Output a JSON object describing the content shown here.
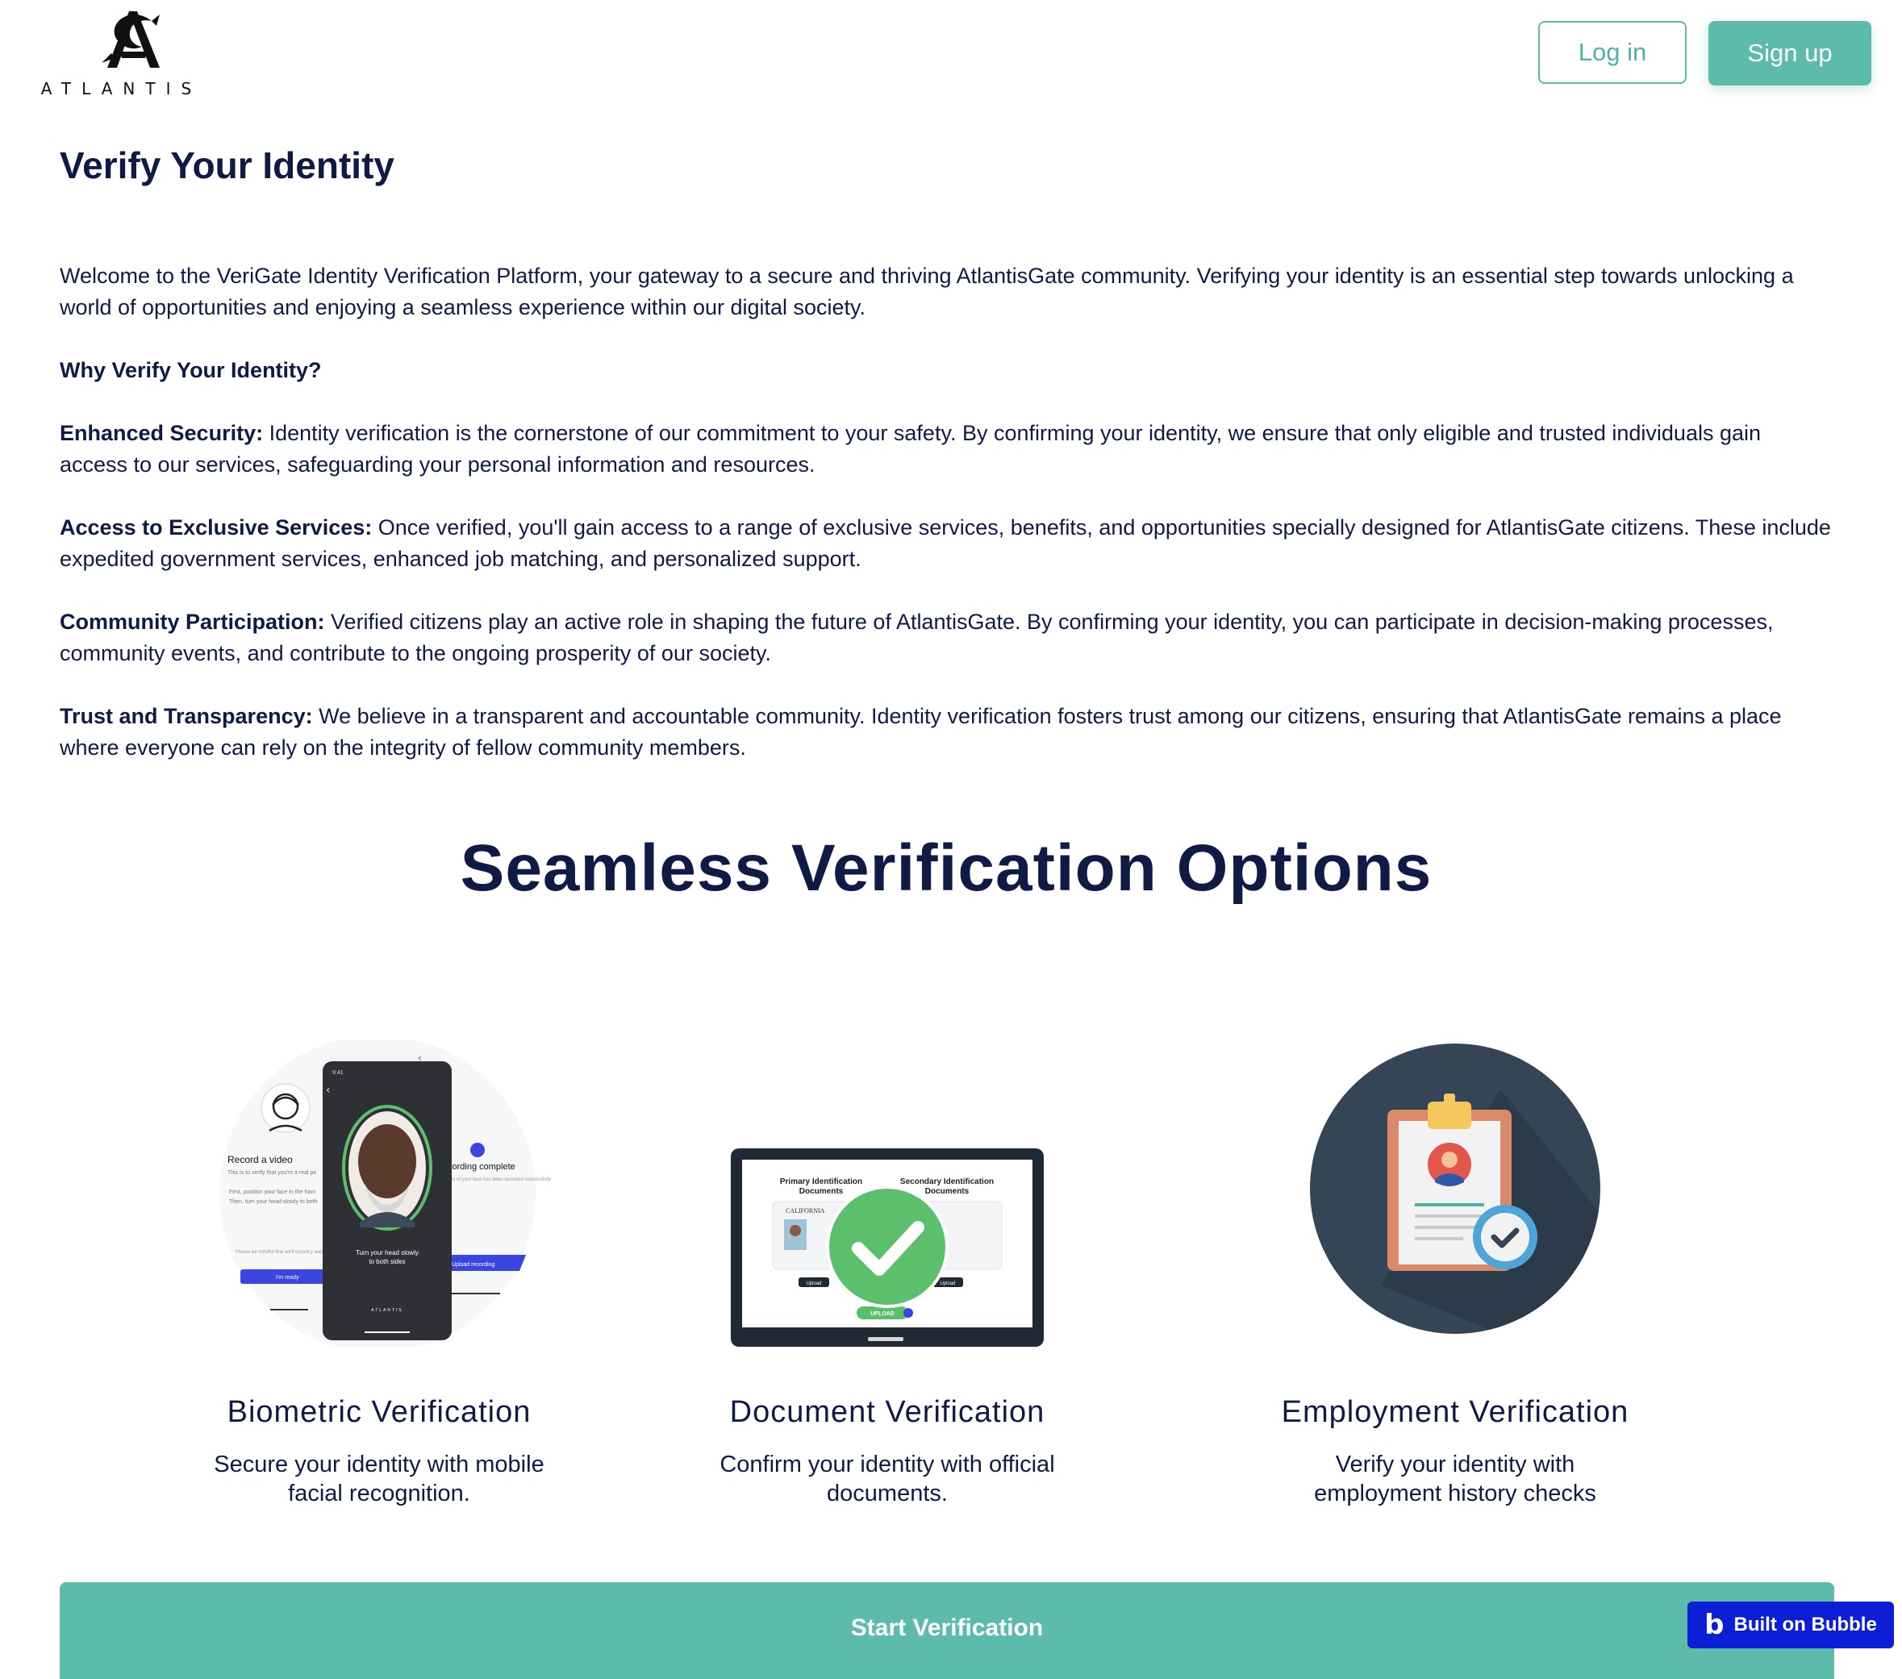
{
  "header": {
    "logo_text": "ATLANTIS",
    "login_label": "Log in",
    "signup_label": "Sign up"
  },
  "page": {
    "title": "Verify Your Identity",
    "intro": "Welcome to the VeriGate Identity Verification Platform, your gateway to a secure and thriving AtlantisGate community. Verifying your identity is an essential step towards unlocking a world of opportunities and enjoying a seamless experience within our digital society.",
    "why_heading": "Why Verify Your Identity?",
    "reasons": [
      {
        "label": "Enhanced Security:",
        "text": " Identity verification is the cornerstone of our commitment to your safety. By confirming your identity, we ensure that only eligible and trusted individuals gain access to our services, safeguarding your personal information and resources."
      },
      {
        "label": "Access to Exclusive Services:",
        "text": " Once verified, you'll gain access to a range of exclusive services, benefits, and opportunities specially designed for AtlantisGate citizens. These include expedited government services, enhanced job matching, and personalized support."
      },
      {
        "label": "Community Participation:",
        "text": " Verified citizens play an active role in shaping the future of AtlantisGate. By confirming your identity, you can participate in decision-making processes, community events, and contribute to the ongoing prosperity of our society."
      },
      {
        "label": "Trust and Transparency:",
        "text": " We believe in a transparent and accountable community. Identity verification fosters trust among our citizens, ensuring that AtlantisGate remains a place where everyone can rely on the integrity of fellow community members."
      }
    ]
  },
  "options": {
    "heading": "Seamless Verification Options",
    "cards": [
      {
        "title": "Biometric Verification",
        "desc": "Secure your identity with mobile facial recognition.",
        "illustration": {
          "record_title": "Record a video",
          "record_sub": "This is to verify that you're a real pe",
          "bullet1": "First, position your face in the fram",
          "bullet2": "Then, turn your head slowly to both",
          "note": "Please be mindful that we'll record y and your background",
          "ready_btn": "I'm ready",
          "phone_time": "9:41",
          "phone_caption_1": "Turn your head slowly",
          "phone_caption_2": "to both sides",
          "phone_logo": "ATLANTIS",
          "complete_title": "cording complete",
          "complete_sub": "es of your face has been recorded successfully",
          "upload_btn": "Upload recording"
        }
      },
      {
        "title": "Document Verification",
        "desc": "Confirm your identity with official documents.",
        "illustration": {
          "primary_label_1": "Primary Identification",
          "primary_label_2": "Documents",
          "secondary_label_1": "Secondary Identification",
          "secondary_label_2": "Documents",
          "card_state": "CALIFORNIA",
          "upload_small": "Upload",
          "upload_main": "UPLOAD"
        }
      },
      {
        "title": "Employment Verification",
        "desc": "Verify your identity with employment history checks"
      }
    ]
  },
  "cta": {
    "start_label": "Start Verification"
  },
  "badge": {
    "label": "Built on Bubble",
    "icon": "b"
  },
  "colors": {
    "navy": "#0f1a45",
    "teal": "#5dbbab",
    "bubble_blue": "#0c1fd6",
    "dark_circle": "#344656",
    "green": "#5cbf6c"
  }
}
